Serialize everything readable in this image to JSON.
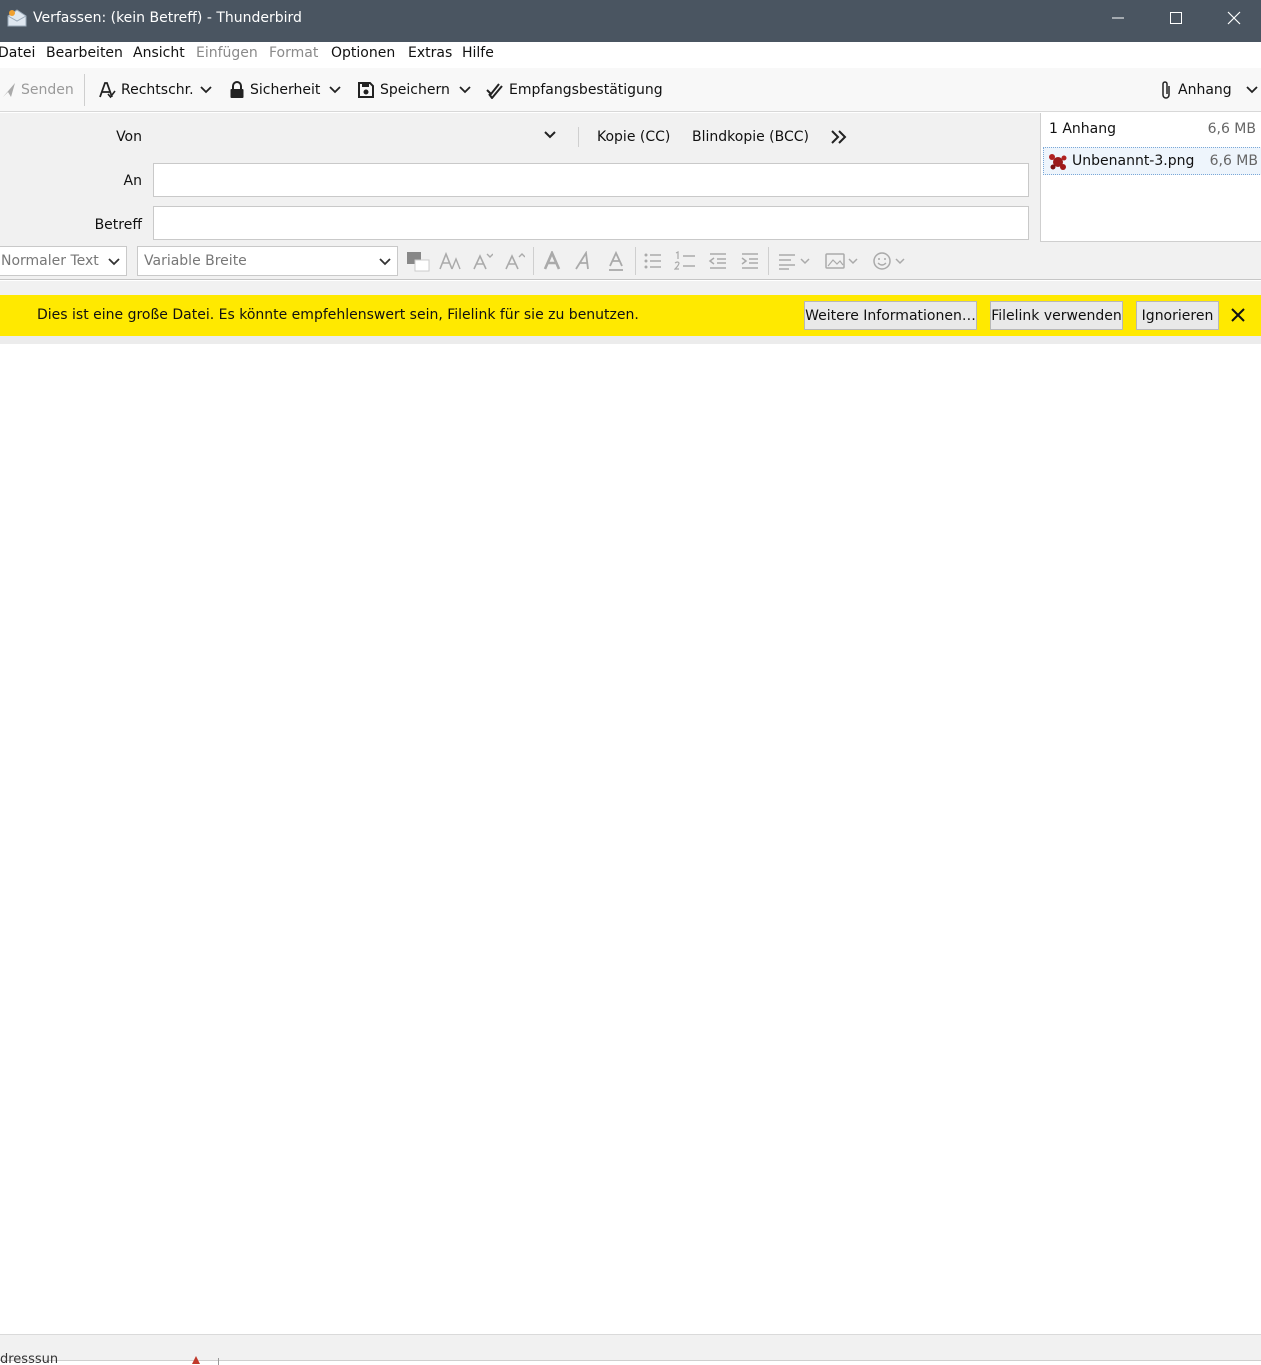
{
  "window": {
    "title": "Verfassen: (kein Betreff) - Thunderbird"
  },
  "menubar": {
    "items": [
      {
        "label": "Datei",
        "enabled": true
      },
      {
        "label": "Bearbeiten",
        "enabled": true
      },
      {
        "label": "Ansicht",
        "enabled": true
      },
      {
        "label": "Einfügen",
        "enabled": false
      },
      {
        "label": "Format",
        "enabled": false
      },
      {
        "label": "Optionen",
        "enabled": true
      },
      {
        "label": "Extras",
        "enabled": true
      },
      {
        "label": "Hilfe",
        "enabled": true
      }
    ]
  },
  "toolbar": {
    "send_label": "Senden",
    "spell_label": "Rechtschr.",
    "security_label": "Sicherheit",
    "save_label": "Speichern",
    "receipt_label": "Empfangsbestätigung",
    "attach_label": "Anhang"
  },
  "header": {
    "from_label": "Von",
    "from_value": "",
    "to_label": "An",
    "to_value": "",
    "subject_label": "Betreff",
    "subject_value": "",
    "cc_label": "Kopie (CC)",
    "bcc_label": "Blindkopie (BCC)"
  },
  "attachments": {
    "count_label": "1 Anhang",
    "total_size": "6,6 MB",
    "items": [
      {
        "name": "Unbenannt-3.png",
        "size": "6,6 MB"
      }
    ]
  },
  "format_bar": {
    "paragraph_format": "Normaler Text",
    "font_family": "Variable Breite"
  },
  "notification": {
    "message": "Dies ist eine große Datei. Es könnte empfehlenswert sein, Filelink für sie zu benutzen.",
    "more_info_label": "Weitere Informationen…",
    "use_filelink_label": "Filelink verwenden",
    "ignore_label": "Ignorieren",
    "background_color": "#ffe900"
  },
  "status": {
    "partial_text": "dresssun"
  },
  "colors": {
    "titlebar": "#4a5561",
    "toolbar": "#f8f8f8",
    "header_bg": "#f1f1f1"
  }
}
